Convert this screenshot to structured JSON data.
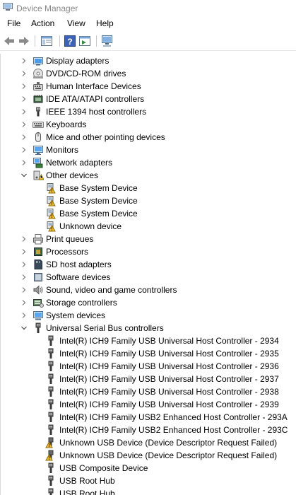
{
  "window": {
    "title": "Device Manager"
  },
  "menu": [
    "File",
    "Action",
    "View",
    "Help"
  ],
  "toolbar": [
    "back",
    "forward",
    "show-hide-console-tree",
    "help",
    "properties-pane",
    "scan-hardware"
  ],
  "tree": [
    {
      "label": "Display adapters",
      "level": 0,
      "expanded": false,
      "icon": "display-adapter-icon"
    },
    {
      "label": "DVD/CD-ROM drives",
      "level": 0,
      "expanded": false,
      "icon": "dvd-drive-icon"
    },
    {
      "label": "Human Interface Devices",
      "level": 0,
      "expanded": false,
      "icon": "hid-icon"
    },
    {
      "label": "IDE ATA/ATAPI controllers",
      "level": 0,
      "expanded": false,
      "icon": "ide-controller-icon"
    },
    {
      "label": "IEEE 1394 host controllers",
      "level": 0,
      "expanded": false,
      "icon": "ieee1394-icon"
    },
    {
      "label": "Keyboards",
      "level": 0,
      "expanded": false,
      "icon": "keyboard-icon"
    },
    {
      "label": "Mice and other pointing devices",
      "level": 0,
      "expanded": false,
      "icon": "mouse-icon"
    },
    {
      "label": "Monitors",
      "level": 0,
      "expanded": false,
      "icon": "monitor-icon"
    },
    {
      "label": "Network adapters",
      "level": 0,
      "expanded": false,
      "icon": "network-adapter-icon"
    },
    {
      "label": "Other devices",
      "level": 0,
      "expanded": true,
      "icon": "other-devices-icon"
    },
    {
      "label": "Base System Device",
      "level": 1,
      "icon": "warning-device-icon"
    },
    {
      "label": "Base System Device",
      "level": 1,
      "icon": "warning-device-icon"
    },
    {
      "label": "Base System Device",
      "level": 1,
      "icon": "warning-device-icon"
    },
    {
      "label": "Unknown device",
      "level": 1,
      "icon": "warning-device-icon"
    },
    {
      "label": "Print queues",
      "level": 0,
      "expanded": false,
      "icon": "printer-icon"
    },
    {
      "label": "Processors",
      "level": 0,
      "expanded": false,
      "icon": "processor-icon"
    },
    {
      "label": "SD host adapters",
      "level": 0,
      "expanded": false,
      "icon": "sd-adapter-icon"
    },
    {
      "label": "Software devices",
      "level": 0,
      "expanded": false,
      "icon": "software-device-icon"
    },
    {
      "label": "Sound, video and game controllers",
      "level": 0,
      "expanded": false,
      "icon": "speaker-icon"
    },
    {
      "label": "Storage controllers",
      "level": 0,
      "expanded": false,
      "icon": "storage-controller-icon"
    },
    {
      "label": "System devices",
      "level": 0,
      "expanded": false,
      "icon": "system-devices-icon"
    },
    {
      "label": "Universal Serial Bus controllers",
      "level": 0,
      "expanded": true,
      "icon": "usb-icon"
    },
    {
      "label": "Intel(R) ICH9 Family USB Universal Host Controller - 2934",
      "level": 1,
      "icon": "usb-icon"
    },
    {
      "label": "Intel(R) ICH9 Family USB Universal Host Controller - 2935",
      "level": 1,
      "icon": "usb-icon"
    },
    {
      "label": "Intel(R) ICH9 Family USB Universal Host Controller - 2936",
      "level": 1,
      "icon": "usb-icon"
    },
    {
      "label": "Intel(R) ICH9 Family USB Universal Host Controller - 2937",
      "level": 1,
      "icon": "usb-icon"
    },
    {
      "label": "Intel(R) ICH9 Family USB Universal Host Controller - 2938",
      "level": 1,
      "icon": "usb-icon"
    },
    {
      "label": "Intel(R) ICH9 Family USB Universal Host Controller - 2939",
      "level": 1,
      "icon": "usb-icon"
    },
    {
      "label": "Intel(R) ICH9 Family USB2 Enhanced Host Controller - 293A",
      "level": 1,
      "icon": "usb-icon"
    },
    {
      "label": "Intel(R) ICH9 Family USB2 Enhanced Host Controller - 293C",
      "level": 1,
      "icon": "usb-icon"
    },
    {
      "label": "Unknown USB Device (Device Descriptor Request Failed)",
      "level": 1,
      "icon": "usb-warning-icon"
    },
    {
      "label": "Unknown USB Device (Device Descriptor Request Failed)",
      "level": 1,
      "icon": "usb-warning-icon"
    },
    {
      "label": "USB Composite Device",
      "level": 1,
      "icon": "usb-icon"
    },
    {
      "label": "USB Root Hub",
      "level": 1,
      "icon": "usb-icon"
    },
    {
      "label": "USB Root Hub",
      "level": 1,
      "icon": "usb-icon"
    }
  ]
}
